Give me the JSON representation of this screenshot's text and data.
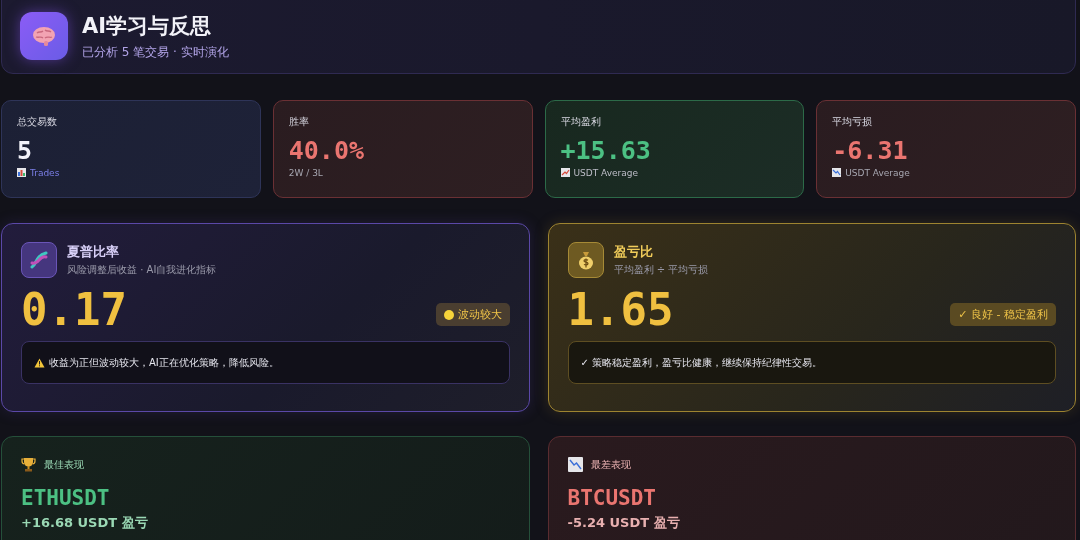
{
  "header": {
    "title": "AI学习与反思",
    "subtitle": "已分析 5 笔交易 · 实时演化"
  },
  "stats": [
    {
      "kind": "neutral",
      "label": "总交易数",
      "value": "5",
      "caption": {
        "kind": "bars",
        "text": "Trades"
      }
    },
    {
      "kind": "loss",
      "label": "胜率",
      "value": "40.0%",
      "caption": {
        "kind": "plain",
        "text": "2W / 3L"
      }
    },
    {
      "kind": "win",
      "label": "平均盈利",
      "value": "+15.63",
      "caption": {
        "kind": "up",
        "text": "USDT Average"
      }
    },
    {
      "kind": "loss",
      "label": "平均亏损",
      "value": "-6.31",
      "caption": {
        "kind": "down",
        "text": "USDT Average"
      }
    }
  ],
  "metrics": [
    {
      "kind": "sharpe",
      "title": "夏普比率",
      "subtitle": "风险调整后收益 · AI自我进化指标",
      "value": "0.17",
      "badge": "波动较大",
      "note": "收益为正但波动较大，AI正在优化策略，降低风险。"
    },
    {
      "kind": "ratio",
      "title": "盈亏比",
      "subtitle": "平均盈利 ÷ 平均亏损",
      "value": "1.65",
      "badge": "✓ 良好 - 稳定盈利",
      "note": "✓ 策略稳定盈利，盈亏比健康，继续保持纪律性交易。"
    }
  ],
  "performance": [
    {
      "kind": "best",
      "title": "最佳表现",
      "symbol": "ETHUSDT",
      "pnl": "+16.68 USDT 盈亏"
    },
    {
      "kind": "worst",
      "title": "最差表现",
      "symbol": "BTCUSDT",
      "pnl": "-5.24 USDT 盈亏"
    }
  ]
}
